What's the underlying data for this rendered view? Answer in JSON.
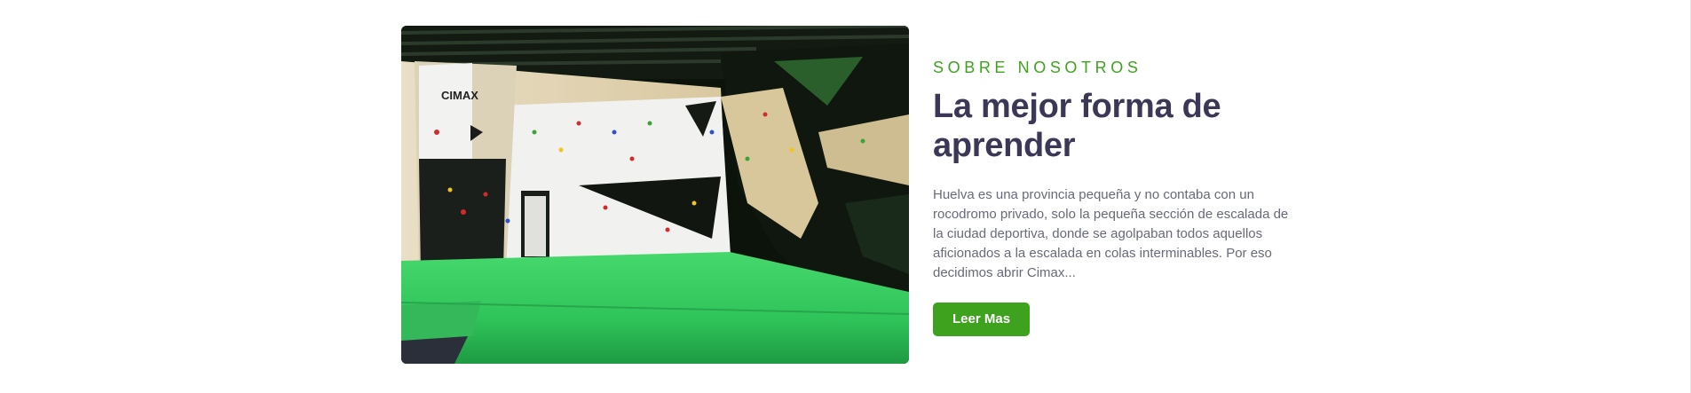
{
  "about": {
    "eyebrow": "SOBRE NOSOTROS",
    "title": "La mejor forma de aprender",
    "description": "Huelva es una provincia pequeña y no contaba con un rocodromo privado, solo la pequeña sección de escalada de la ciudad deportiva, donde se agolpaban todos aquellos aficionados a la escalada en colas interminables. Por eso decidimos abrir Cimax...",
    "button_label": "Leer Mas"
  },
  "photo": {
    "sign_text": "CIMAX"
  },
  "colors": {
    "accent": "#3fa21f",
    "heading": "#3a3856",
    "body_text": "#676a78",
    "mat_green": "#2fc45a"
  }
}
